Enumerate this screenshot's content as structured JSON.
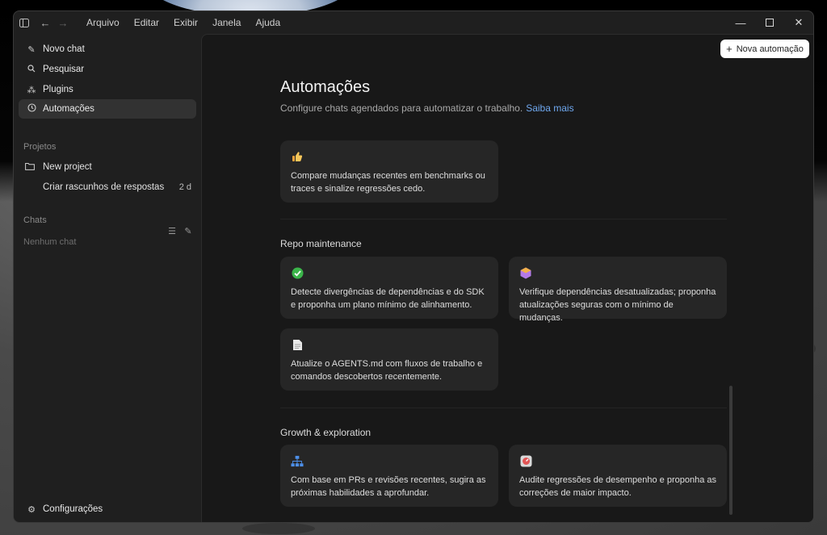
{
  "menu": {
    "items": [
      "Arquivo",
      "Editar",
      "Exibir",
      "Janela",
      "Ajuda"
    ]
  },
  "sidebar": {
    "nav": [
      {
        "label": "Novo chat",
        "icon": "compose-icon"
      },
      {
        "label": "Pesquisar",
        "icon": "search-icon"
      },
      {
        "label": "Plugins",
        "icon": "plugins-icon"
      },
      {
        "label": "Automações",
        "icon": "clock-icon"
      }
    ],
    "projects_label": "Projetos",
    "projects": [
      {
        "label": "New project",
        "meta": ""
      },
      {
        "label": "Criar rascunhos de respostas",
        "meta": "2 d"
      }
    ],
    "chats_label": "Chats",
    "empty_chats": "Nenhum chat",
    "settings_label": "Configurações"
  },
  "main": {
    "new_button": "Nova automação",
    "title": "Automações",
    "subtitle": "Configure chats agendados para automatizar o trabalho.",
    "learn_more": "Saiba mais",
    "groups": [
      {
        "title": "",
        "cards": [
          {
            "icon": "thumbs-up-icon",
            "text": "Compare mudanças recentes em benchmarks ou traces e sinalize regressões cedo."
          }
        ]
      },
      {
        "title": "Repo maintenance",
        "cards": [
          {
            "icon": "check-circle-icon",
            "text": "Detecte divergências de dependências e do SDK e proponha um plano mínimo de alinhamento."
          },
          {
            "icon": "package-icon",
            "text": "Verifique dependências desatualizadas; proponha atualizações seguras com o mínimo de mudanças."
          },
          {
            "icon": "document-icon",
            "text": "Atualize o AGENTS.md com fluxos de trabalho e comandos descobertos recentemente."
          }
        ]
      },
      {
        "title": "Growth & exploration",
        "cards": [
          {
            "icon": "hierarchy-icon",
            "text": "Com base em PRs e revisões recentes, sugira as próximas habilidades a aprofundar."
          },
          {
            "icon": "gauge-icon",
            "text": "Audite regressões de desempenho e proponha as correções de maior impacto."
          }
        ]
      }
    ]
  }
}
